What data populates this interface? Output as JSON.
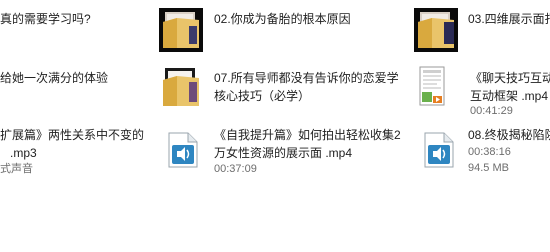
{
  "files": [
    {
      "id": "r1c1",
      "name_line1": "真的需要学习吗?",
      "name_line2": "",
      "meta1": "",
      "meta2": "",
      "icon": "none"
    },
    {
      "id": "r1c2",
      "name_line1": "02.你成为备胎的根本原因",
      "name_line2": "",
      "meta1": "",
      "meta2": "",
      "icon": "video-folder-icon"
    },
    {
      "id": "r1c3",
      "name_line1": "03.四维展示面打",
      "name_line2": "",
      "meta1": "",
      "meta2": "",
      "icon": "video-folder-icon"
    },
    {
      "id": "r2c1",
      "name_line1": "给她一次满分的体验",
      "name_line2": "",
      "meta1": "",
      "meta2": "",
      "icon": "none"
    },
    {
      "id": "r2c2",
      "name_line1": "07.所有导师都没有告诉你的恋爱学",
      "name_line2": "核心技巧（必学）",
      "meta1": "",
      "meta2": "",
      "icon": "video-folder-icon"
    },
    {
      "id": "r2c3",
      "name_line1": "《聊天技巧互动",
      "name_line2": "互动框架  .mp4",
      "meta1": "00:41:29",
      "meta2": "",
      "icon": "video-file-icon"
    },
    {
      "id": "r3c1",
      "name_line1": "扩展篇》两性关系中不变的",
      "name_line2": ".mp3",
      "meta1": "式声音",
      "meta2": "",
      "icon": "none"
    },
    {
      "id": "r3c2",
      "name_line1": "《自我提升篇》如何拍出轻松收集2",
      "name_line2": "万女性资源的展示面  .mp4",
      "meta1": "00:37:09",
      "meta2": "",
      "icon": "audio-file-icon"
    },
    {
      "id": "r3c3",
      "name_line1": "08.终极揭秘陷阱",
      "name_line2": "00:38:16",
      "meta1": "94.5 MB",
      "meta2": "",
      "icon": "audio-file-icon"
    }
  ],
  "colors": {
    "text": "#1f1f1f",
    "meta": "#6d6d6d",
    "background": "#ffffff"
  }
}
